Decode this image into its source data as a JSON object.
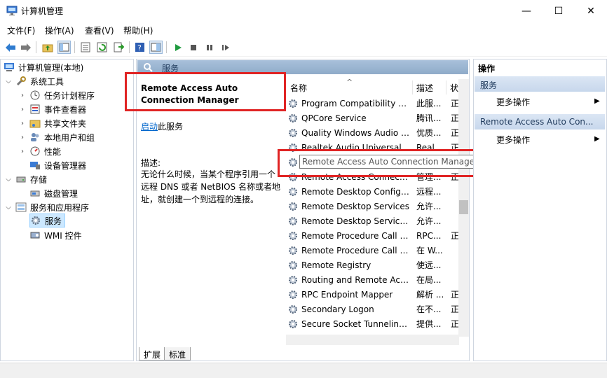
{
  "window": {
    "title": "计算机管理",
    "minimize_glyph": "—",
    "maximize_glyph": "☐",
    "close_glyph": "✕"
  },
  "menu": [
    "文件(F)",
    "操作(A)",
    "查看(V)",
    "帮助(H)"
  ],
  "toolbar_icons": [
    "back-arrow-icon",
    "forward-arrow-icon",
    "up-folder-icon",
    "console-tree-icon",
    "properties-icon",
    "refresh-icon",
    "export-icon",
    "help-icon",
    "view-icon",
    "play-icon",
    "stop-icon",
    "pause-icon",
    "resume-icon"
  ],
  "tree": {
    "root": "计算机管理(本地)",
    "system_tools": "系统工具",
    "task_scheduler": "任务计划程序",
    "event_viewer": "事件查看器",
    "shared_folders": "共享文件夹",
    "local_users": "本地用户和组",
    "performance": "性能",
    "device_manager": "设备管理器",
    "storage": "存储",
    "disk_management": "磁盘管理",
    "services_apps": "服务和应用程序",
    "services": "服务",
    "wmi": "WMI 控件"
  },
  "services_header": "服务",
  "detail": {
    "service_name": "Remote Access Auto Connection Manager",
    "start_link": "启动",
    "start_suffix": "此服务",
    "desc_label": "描述:",
    "desc_text": "无论什么时候，当某个程序引用一个远程 DNS 或者 NetBIOS 名称或者地址，就创建一个到远程的连接。"
  },
  "list": {
    "col_name": "名称",
    "col_desc": "描述",
    "col_status": "状",
    "rows": [
      {
        "name": "Program Compatibility A...",
        "desc": "此服...",
        "status": "正"
      },
      {
        "name": "QPCore Service",
        "desc": "腾讯...",
        "status": "正"
      },
      {
        "name": "Quality Windows Audio V...",
        "desc": "优质...",
        "status": "正"
      },
      {
        "name": "Realtek Audio Universal ...",
        "desc": "Real...",
        "status": "正"
      },
      {
        "name": "Remote Access Auto Connection Manager",
        "desc": "",
        "status": ""
      },
      {
        "name": "Remote Access Connecti...",
        "desc": "管理...",
        "status": "正"
      },
      {
        "name": "Remote Desktop Configu...",
        "desc": "远程...",
        "status": ""
      },
      {
        "name": "Remote Desktop Services",
        "desc": "允许...",
        "status": ""
      },
      {
        "name": "Remote Desktop Service...",
        "desc": "允许...",
        "status": ""
      },
      {
        "name": "Remote Procedure Call (...",
        "desc": "RPC...",
        "status": "正"
      },
      {
        "name": "Remote Procedure Call (...",
        "desc": "在 W...",
        "status": ""
      },
      {
        "name": "Remote Registry",
        "desc": "使远...",
        "status": ""
      },
      {
        "name": "Routing and Remote Acc...",
        "desc": "在局...",
        "status": ""
      },
      {
        "name": "RPC Endpoint Mapper",
        "desc": "解析 ...",
        "status": "正"
      },
      {
        "name": "Secondary Logon",
        "desc": "在不...",
        "status": "正"
      },
      {
        "name": "Secure Socket Tunneling ...",
        "desc": "提供...",
        "status": "正"
      }
    ]
  },
  "tooltip": "Remote Access Auto Connection Manager",
  "tabs": [
    "扩展",
    "标准"
  ],
  "actions": {
    "title": "操作",
    "group1": "服务",
    "more1": "更多操作",
    "group2": "Remote Access Auto Con...",
    "more2": "更多操作"
  }
}
